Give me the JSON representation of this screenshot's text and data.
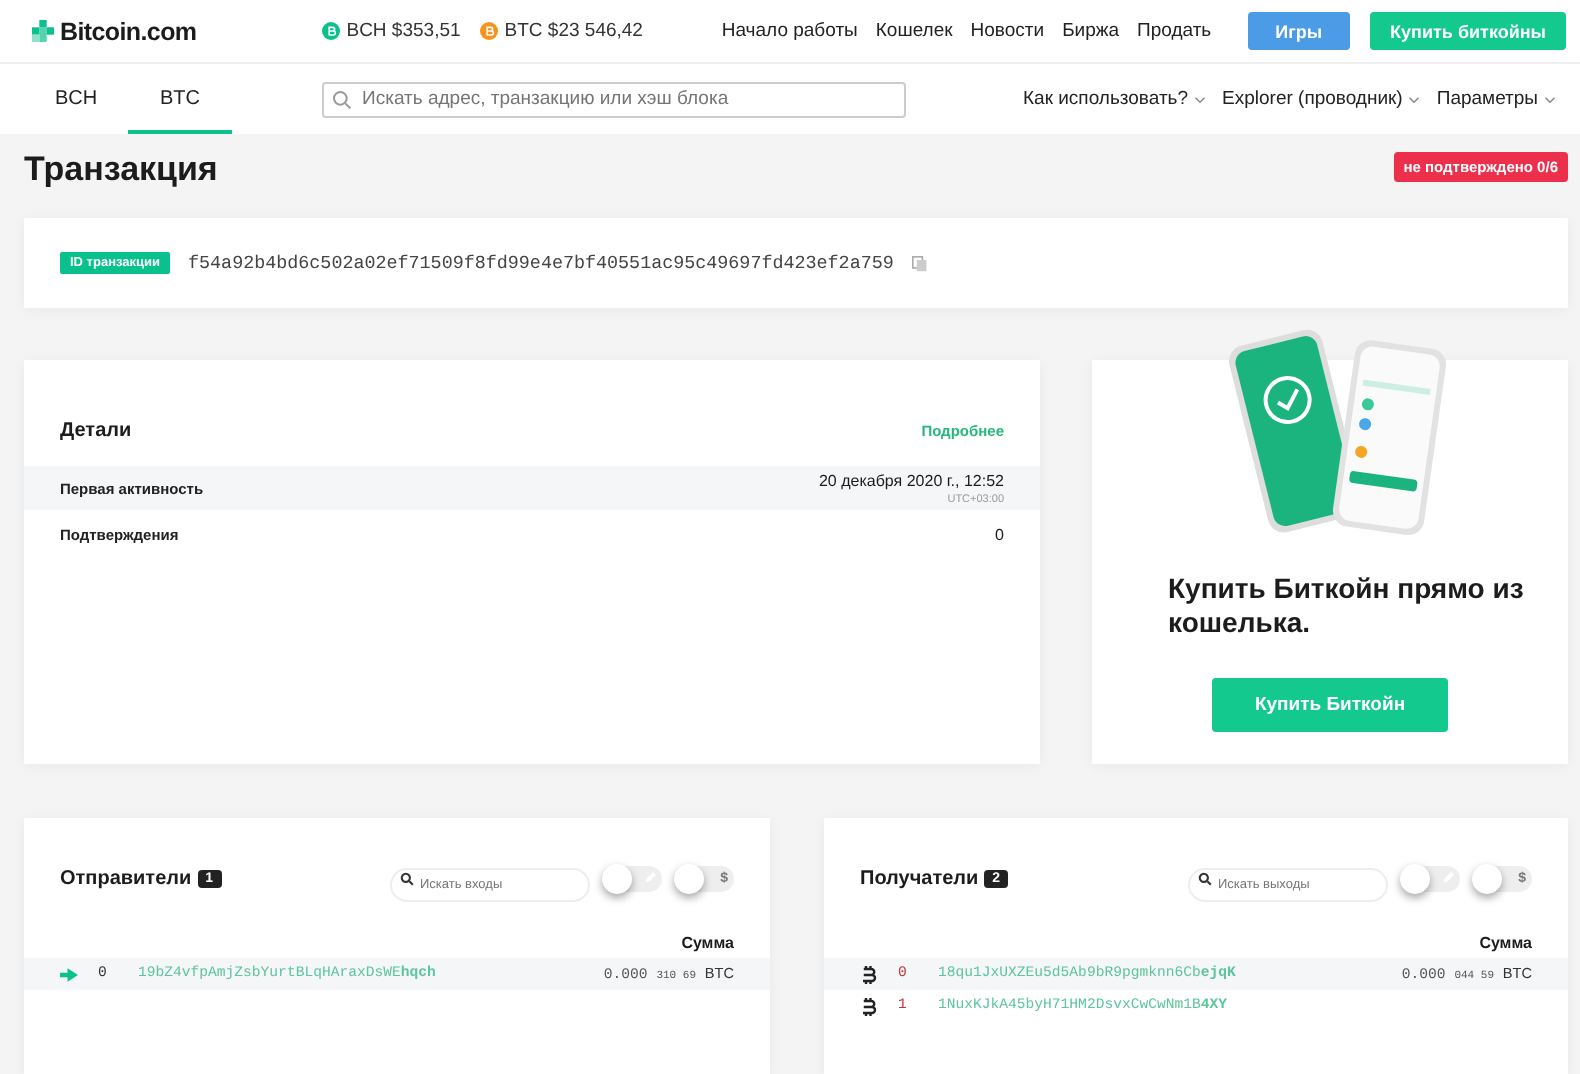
{
  "header": {
    "logo": "Bitcoin.com",
    "prices": [
      {
        "color": "#0ac18e",
        "label": "BCH $353,51"
      },
      {
        "color": "#f7931a",
        "label": "BTC $23 546,42"
      }
    ],
    "links": [
      "Начало работы",
      "Кошелек",
      "Новости",
      "Биржа",
      "Продать"
    ],
    "buttons": [
      {
        "kind": "blue",
        "label": "Игры"
      },
      {
        "kind": "green",
        "label": "Купить биткойны"
      }
    ]
  },
  "subnav": {
    "tabs": [
      {
        "label": "BCH",
        "selected": false
      },
      {
        "label": "BTC",
        "selected": true
      }
    ],
    "search": {
      "placeholder": "Искать адрес, транзакцию или хэш блока"
    },
    "menus": [
      "Как использовать?",
      "Explorer (проводник)",
      "Параметры"
    ]
  },
  "page": {
    "title": "Транзакция",
    "status_badge": "не подтверждено 0/6"
  },
  "txid": {
    "label": "ID транзакции",
    "value": "f54a92b4bd6c502a02ef71509f8fd99e4e7bf40551ac95c49697fd423ef2a759"
  },
  "details": {
    "title": "Детали",
    "more_link": "Подробнее",
    "rows": [
      {
        "label": "Первая активность",
        "value": "20 декабря 2020 г., 12:52",
        "sub": "UTC+03:00",
        "shaded": true
      },
      {
        "label": "Подтверждения",
        "value": "0",
        "shaded": false
      }
    ]
  },
  "promo": {
    "headline": "Купить **Биткойн** прямо из кошелька.",
    "button": "Купить Биткойн"
  },
  "inputs": {
    "title": "Отправители",
    "count": "1",
    "search": {
      "placeholder": "Искать входы"
    },
    "toggles": [
      {
        "kind": "pencil",
        "on": false
      },
      {
        "kind": "dollar",
        "label": "$",
        "on": false
      }
    ],
    "column": "Сумма",
    "rows": [
      {
        "kind": "arrow",
        "index": "0",
        "address": "19bZ4vfpAmjZsbYurtBLqHAraxDsWE**hqch**",
        "amount": "0.000",
        "amount_small": "310 69",
        "unit": "BTC"
      }
    ]
  },
  "outputs": {
    "title": "Получатели",
    "count": "2",
    "search": {
      "placeholder": "Искать выходы"
    },
    "toggles": [
      {
        "kind": "pencil",
        "on": false
      },
      {
        "kind": "dollar",
        "label": "$",
        "on": false
      }
    ],
    "column": "Сумма",
    "rows": [
      {
        "kind": "bitcoin",
        "index": "0",
        "address": "18qu1JxUXZEu5d5Ab9bR9pgmknn6Cb**ejqK**",
        "amount": "0.000",
        "amount_small": "044 59",
        "unit": "BTC"
      },
      {
        "kind": "bitcoin",
        "index": "1",
        "address": "1NuxKJkA45byH71HM2DsvxCwCwNm1B**4XY**"
      }
    ]
  }
}
